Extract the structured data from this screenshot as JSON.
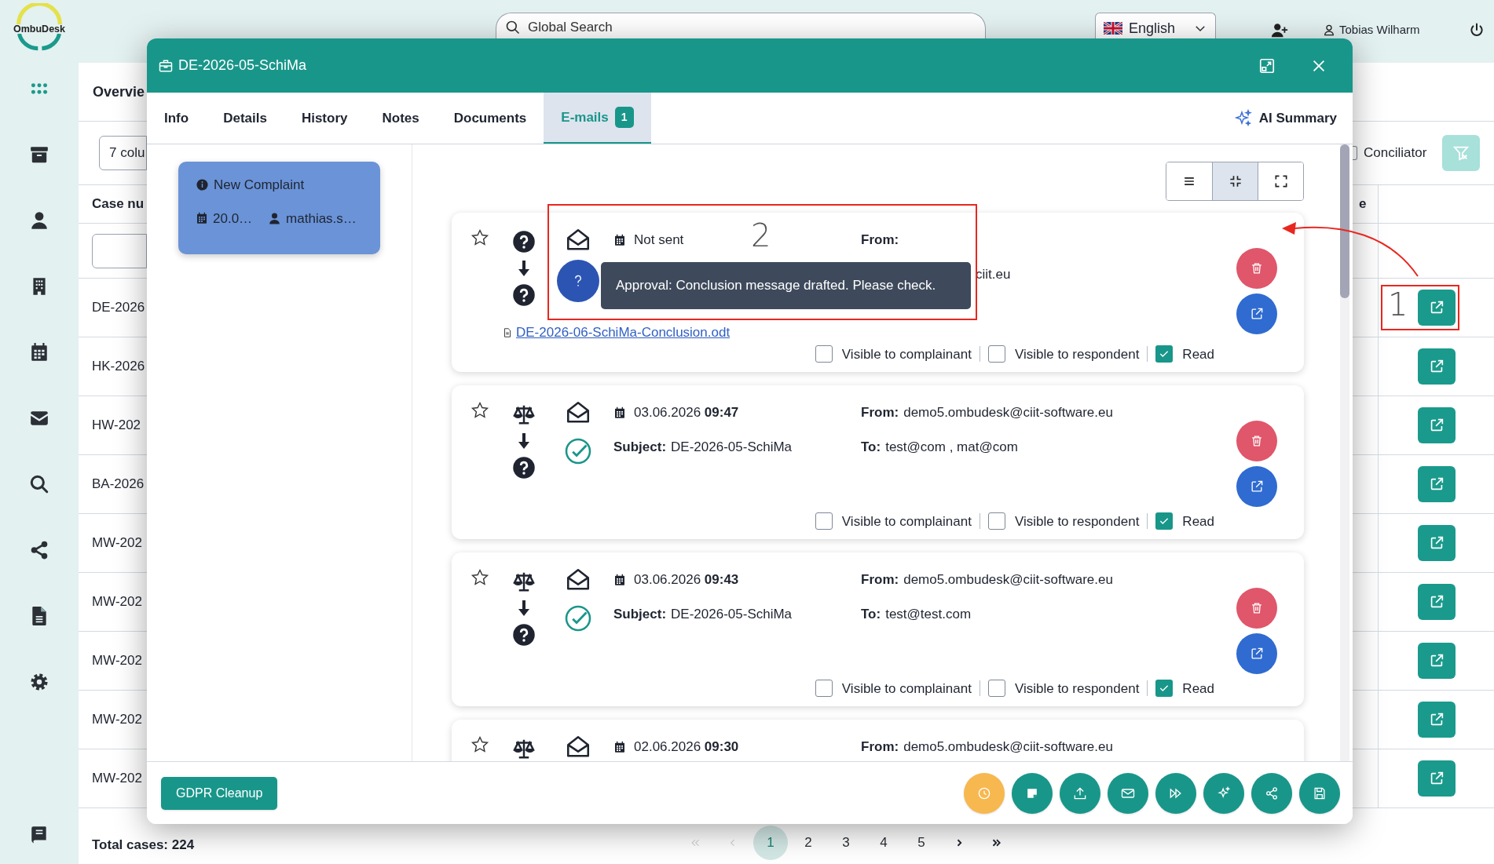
{
  "logo": {
    "text": "OmbuDesk"
  },
  "sidebar": {
    "items": [
      {
        "selected": true
      },
      {
        "selected": false
      },
      {
        "selected": false
      },
      {
        "selected": false
      },
      {
        "selected": false
      },
      {
        "selected": false
      },
      {
        "selected": false
      },
      {
        "selected": false
      },
      {
        "selected": false
      },
      {
        "selected": false
      }
    ],
    "bottom_item": {
      "selected": false
    }
  },
  "topbar": {
    "search": {
      "placeholder": "Global Search"
    },
    "language": {
      "value": "English"
    },
    "user": {
      "name": "Tobias Wilharm"
    }
  },
  "overview": {
    "title": "Overvie",
    "columns_select": "7 colu",
    "conciliator": {
      "label": "Conciliator",
      "checked": false
    },
    "table": {
      "columns": [
        "Case nu",
        "e"
      ],
      "rows": [
        {
          "case_number": "DE-2026"
        },
        {
          "case_number": "HK-2026"
        },
        {
          "case_number": "HW-202"
        },
        {
          "case_number": "BA-2026"
        },
        {
          "case_number": "MW-202"
        },
        {
          "case_number": "MW-202"
        },
        {
          "case_number": "MW-202"
        },
        {
          "case_number": "MW-202"
        },
        {
          "case_number": "MW-202"
        }
      ]
    },
    "total": "Total cases: 224",
    "pagination": {
      "nav": [
        {
          "kind": "first",
          "disabled": true
        },
        {
          "kind": "prev",
          "disabled": true
        },
        {
          "kind": "next",
          "disabled": false
        },
        {
          "kind": "last",
          "disabled": false
        }
      ],
      "pages": [
        {
          "label": "1",
          "selected": true
        },
        {
          "label": "2",
          "selected": false
        },
        {
          "label": "3",
          "selected": false
        },
        {
          "label": "4",
          "selected": false
        },
        {
          "label": "5",
          "selected": false
        }
      ]
    }
  },
  "modal": {
    "title": "DE-2026-05-SchiMa",
    "tabs": [
      {
        "label": "Info",
        "selected": false
      },
      {
        "label": "Details",
        "selected": false
      },
      {
        "label": "History",
        "selected": false
      },
      {
        "label": "Notes",
        "selected": false
      },
      {
        "label": "Documents",
        "selected": false
      },
      {
        "label": "E-mails",
        "selected": true,
        "badge": "1"
      }
    ],
    "ai_summary": "AI Summary",
    "events": [
      {
        "title": "New Complaint",
        "date": "20.0…",
        "user": "mathias.s…"
      }
    ],
    "view_toggle": [
      {
        "selected": false
      },
      {
        "selected": true
      },
      {
        "selected": false
      }
    ],
    "emails": [
      {
        "starred": false,
        "flow": [
          {
            "kind": "question"
          },
          {
            "kind": "question"
          }
        ],
        "status": {
          "kind": "pending"
        },
        "date": "Not sent",
        "from": {
          "label": "From:"
        },
        "to": {
          "value": "ciit.eu"
        },
        "tooltip": "Approval: Conclusion message drafted. Please check.",
        "attachment": "DE-2026-06-SchiMa-Conclusion.odt",
        "flags": [
          {
            "label": "Visible to complainant",
            "checked": false
          },
          {
            "label": "Visible to respondent",
            "checked": false
          },
          {
            "label": "Read",
            "checked": true
          }
        ]
      },
      {
        "starred": false,
        "flow": [
          {
            "kind": "scales"
          },
          {
            "kind": "question"
          }
        ],
        "status": {
          "kind": "sent"
        },
        "date": "03.06.2026",
        "time": "09:47",
        "from": {
          "label": "From:",
          "value": "demo5.ombudesk@ciit-software.eu"
        },
        "subject": {
          "label": "Subject:",
          "value": "DE-2026-05-SchiMa"
        },
        "to": {
          "label": "To:",
          "value": "test@com , mat@com"
        },
        "flags": [
          {
            "label": "Visible to complainant",
            "checked": false
          },
          {
            "label": "Visible to respondent",
            "checked": false
          },
          {
            "label": "Read",
            "checked": true
          }
        ]
      },
      {
        "starred": false,
        "flow": [
          {
            "kind": "scales"
          },
          {
            "kind": "question"
          }
        ],
        "status": {
          "kind": "sent"
        },
        "date": "03.06.2026",
        "time": "09:43",
        "from": {
          "label": "From:",
          "value": "demo5.ombudesk@ciit-software.eu"
        },
        "subject": {
          "label": "Subject:",
          "value": "DE-2026-05-SchiMa"
        },
        "to": {
          "label": "To:",
          "value": "test@test.com"
        },
        "flags": [
          {
            "label": "Visible to complainant",
            "checked": false
          },
          {
            "label": "Visible to respondent",
            "checked": false
          },
          {
            "label": "Read",
            "checked": true
          }
        ]
      },
      {
        "starred": false,
        "flow": [
          {
            "kind": "scales"
          }
        ],
        "date": "02.06.2026",
        "time": "09:30",
        "from": {
          "label": "From:",
          "value": "demo5.ombudesk@ciit-software.eu"
        }
      }
    ],
    "gdpr_button": "GDPR Cleanup"
  },
  "annotations": [
    {
      "label": "1"
    },
    {
      "label": "2"
    }
  ]
}
